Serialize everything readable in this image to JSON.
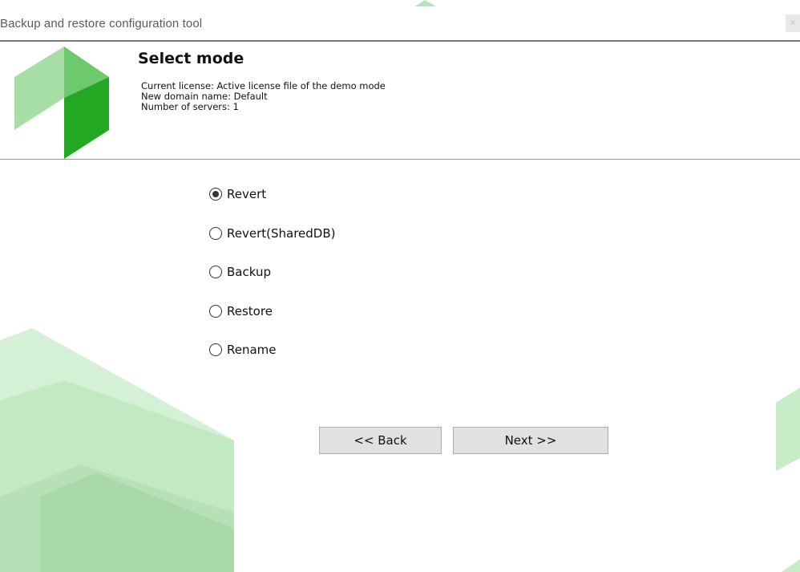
{
  "window": {
    "title": "Backup and restore configuration tool",
    "close_label": "×"
  },
  "header": {
    "title": "Select mode",
    "info_lines": [
      "Current license: Active license file of the demo mode",
      "New domain name: Default",
      "Number of servers: 1"
    ]
  },
  "options": [
    {
      "label": "Revert",
      "checked": true
    },
    {
      "label": "Revert(SharedDB)",
      "checked": false
    },
    {
      "label": "Backup",
      "checked": false
    },
    {
      "label": "Restore",
      "checked": false
    },
    {
      "label": "Rename",
      "checked": false
    }
  ],
  "buttons": {
    "back": "<< Back",
    "next": "Next >>"
  },
  "colors": {
    "accent_dark": "#22a822",
    "accent_mid": "#6cc96c",
    "accent_light": "#a6dea6",
    "deco": "#c8ecc8"
  },
  "icons": {
    "logo": "green-hexagon-logo",
    "close": "close-icon"
  }
}
